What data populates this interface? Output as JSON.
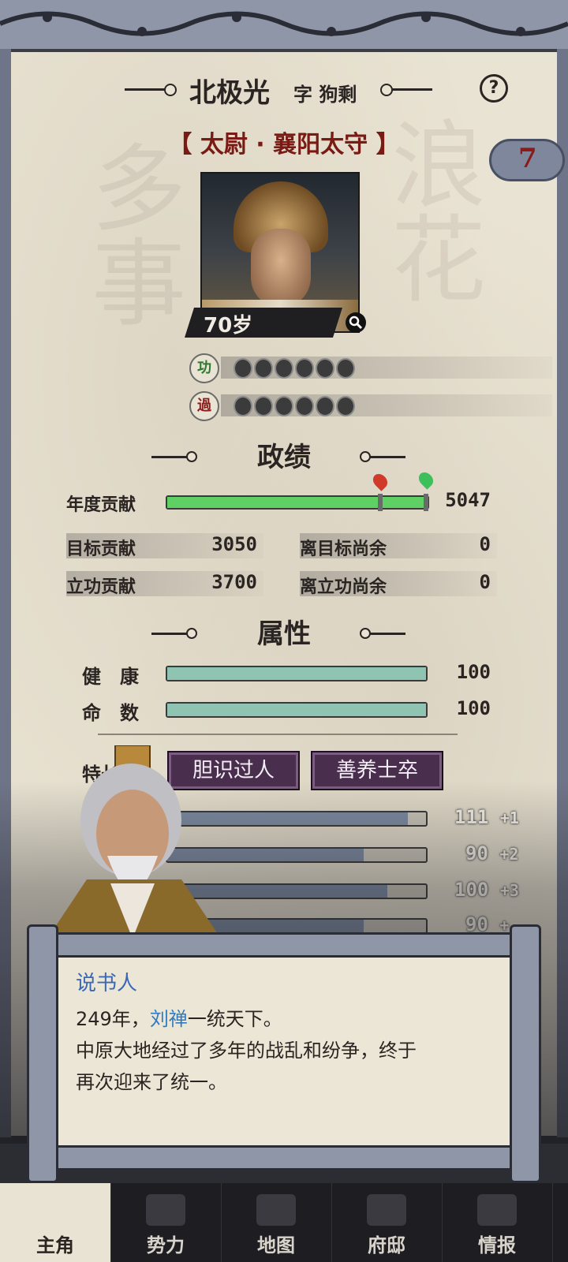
{
  "header": {
    "name": "北极光",
    "courtesy_prefix": "字",
    "courtesy_name": "狗剩",
    "help_glyph": "?",
    "titles": "【 太尉 · 襄阳太守 】",
    "badge_count": "7"
  },
  "portrait": {
    "age": "70岁"
  },
  "merit": {
    "icon_text": "功",
    "count": 6
  },
  "fault": {
    "icon_text": "過",
    "count": 6
  },
  "performance": {
    "heading": "政绩",
    "annual_label": "年度贡献",
    "annual_value": "5047",
    "annual_progress": 1.0,
    "target_label": "目标贡献",
    "target_value": "3050",
    "target_remaining_label": "离目标尚余",
    "target_remaining_value": "0",
    "merit_label": "立功贡献",
    "merit_value": "3700",
    "merit_remaining_label": "离立功尚余",
    "merit_remaining_value": "0"
  },
  "attributes": {
    "heading": "属性",
    "health_label": "健　康",
    "health_value": "100",
    "health_fill": 1.0,
    "fate_label": "命　数",
    "fate_value": "100",
    "fate_fill": 1.0,
    "traits_label": "特长",
    "traits": [
      "胆识过人",
      "善养士卒"
    ],
    "stats": [
      {
        "value": "111",
        "bonus": "+1",
        "fill": 0.93
      },
      {
        "value": "90",
        "bonus": "+2",
        "fill": 0.76
      },
      {
        "value": "100",
        "bonus": "+3",
        "fill": 0.85
      },
      {
        "value": "90",
        "bonus": "+",
        "fill": 0.76
      }
    ]
  },
  "dialog": {
    "speaker": "说书人",
    "line1_pre": "249年，",
    "line1_name": "刘禅",
    "line1_post": "一统天下。",
    "line2": "中原大地经过了多年的战乱和纷争，终于",
    "line3": "再次迎来了统一。"
  },
  "nav": {
    "items": [
      "主角",
      "势力",
      "地图",
      "府邸",
      "情报"
    ],
    "active": 0
  },
  "colors": {
    "accent_red": "#7a1a14",
    "progress_green": "#5fd064",
    "attr_teal": "#8fc4b2",
    "trait_purple": "#4a2e4e",
    "speaker_blue": "#3a68b8"
  }
}
